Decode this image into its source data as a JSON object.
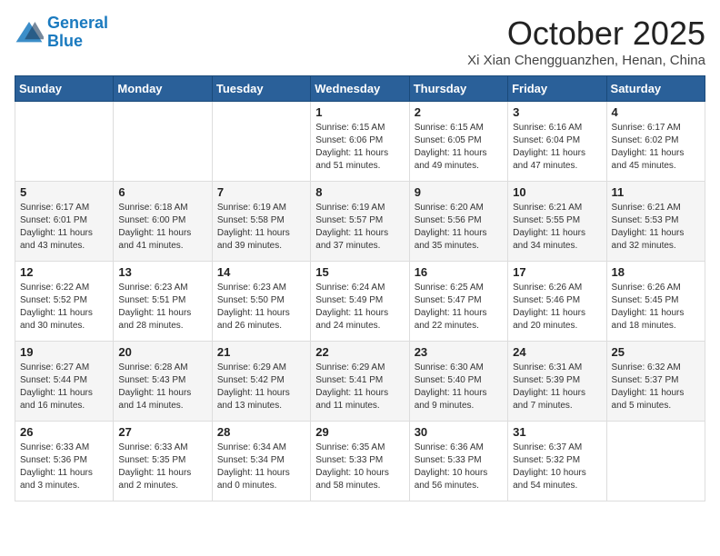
{
  "logo": {
    "line1": "General",
    "line2": "Blue"
  },
  "title": "October 2025",
  "location": "Xi Xian Chengguanzhen, Henan, China",
  "weekdays": [
    "Sunday",
    "Monday",
    "Tuesday",
    "Wednesday",
    "Thursday",
    "Friday",
    "Saturday"
  ],
  "weeks": [
    [
      {
        "day": "",
        "info": ""
      },
      {
        "day": "",
        "info": ""
      },
      {
        "day": "",
        "info": ""
      },
      {
        "day": "1",
        "info": "Sunrise: 6:15 AM\nSunset: 6:06 PM\nDaylight: 11 hours\nand 51 minutes."
      },
      {
        "day": "2",
        "info": "Sunrise: 6:15 AM\nSunset: 6:05 PM\nDaylight: 11 hours\nand 49 minutes."
      },
      {
        "day": "3",
        "info": "Sunrise: 6:16 AM\nSunset: 6:04 PM\nDaylight: 11 hours\nand 47 minutes."
      },
      {
        "day": "4",
        "info": "Sunrise: 6:17 AM\nSunset: 6:02 PM\nDaylight: 11 hours\nand 45 minutes."
      }
    ],
    [
      {
        "day": "5",
        "info": "Sunrise: 6:17 AM\nSunset: 6:01 PM\nDaylight: 11 hours\nand 43 minutes."
      },
      {
        "day": "6",
        "info": "Sunrise: 6:18 AM\nSunset: 6:00 PM\nDaylight: 11 hours\nand 41 minutes."
      },
      {
        "day": "7",
        "info": "Sunrise: 6:19 AM\nSunset: 5:58 PM\nDaylight: 11 hours\nand 39 minutes."
      },
      {
        "day": "8",
        "info": "Sunrise: 6:19 AM\nSunset: 5:57 PM\nDaylight: 11 hours\nand 37 minutes."
      },
      {
        "day": "9",
        "info": "Sunrise: 6:20 AM\nSunset: 5:56 PM\nDaylight: 11 hours\nand 35 minutes."
      },
      {
        "day": "10",
        "info": "Sunrise: 6:21 AM\nSunset: 5:55 PM\nDaylight: 11 hours\nand 34 minutes."
      },
      {
        "day": "11",
        "info": "Sunrise: 6:21 AM\nSunset: 5:53 PM\nDaylight: 11 hours\nand 32 minutes."
      }
    ],
    [
      {
        "day": "12",
        "info": "Sunrise: 6:22 AM\nSunset: 5:52 PM\nDaylight: 11 hours\nand 30 minutes."
      },
      {
        "day": "13",
        "info": "Sunrise: 6:23 AM\nSunset: 5:51 PM\nDaylight: 11 hours\nand 28 minutes."
      },
      {
        "day": "14",
        "info": "Sunrise: 6:23 AM\nSunset: 5:50 PM\nDaylight: 11 hours\nand 26 minutes."
      },
      {
        "day": "15",
        "info": "Sunrise: 6:24 AM\nSunset: 5:49 PM\nDaylight: 11 hours\nand 24 minutes."
      },
      {
        "day": "16",
        "info": "Sunrise: 6:25 AM\nSunset: 5:47 PM\nDaylight: 11 hours\nand 22 minutes."
      },
      {
        "day": "17",
        "info": "Sunrise: 6:26 AM\nSunset: 5:46 PM\nDaylight: 11 hours\nand 20 minutes."
      },
      {
        "day": "18",
        "info": "Sunrise: 6:26 AM\nSunset: 5:45 PM\nDaylight: 11 hours\nand 18 minutes."
      }
    ],
    [
      {
        "day": "19",
        "info": "Sunrise: 6:27 AM\nSunset: 5:44 PM\nDaylight: 11 hours\nand 16 minutes."
      },
      {
        "day": "20",
        "info": "Sunrise: 6:28 AM\nSunset: 5:43 PM\nDaylight: 11 hours\nand 14 minutes."
      },
      {
        "day": "21",
        "info": "Sunrise: 6:29 AM\nSunset: 5:42 PM\nDaylight: 11 hours\nand 13 minutes."
      },
      {
        "day": "22",
        "info": "Sunrise: 6:29 AM\nSunset: 5:41 PM\nDaylight: 11 hours\nand 11 minutes."
      },
      {
        "day": "23",
        "info": "Sunrise: 6:30 AM\nSunset: 5:40 PM\nDaylight: 11 hours\nand 9 minutes."
      },
      {
        "day": "24",
        "info": "Sunrise: 6:31 AM\nSunset: 5:39 PM\nDaylight: 11 hours\nand 7 minutes."
      },
      {
        "day": "25",
        "info": "Sunrise: 6:32 AM\nSunset: 5:37 PM\nDaylight: 11 hours\nand 5 minutes."
      }
    ],
    [
      {
        "day": "26",
        "info": "Sunrise: 6:33 AM\nSunset: 5:36 PM\nDaylight: 11 hours\nand 3 minutes."
      },
      {
        "day": "27",
        "info": "Sunrise: 6:33 AM\nSunset: 5:35 PM\nDaylight: 11 hours\nand 2 minutes."
      },
      {
        "day": "28",
        "info": "Sunrise: 6:34 AM\nSunset: 5:34 PM\nDaylight: 11 hours\nand 0 minutes."
      },
      {
        "day": "29",
        "info": "Sunrise: 6:35 AM\nSunset: 5:33 PM\nDaylight: 10 hours\nand 58 minutes."
      },
      {
        "day": "30",
        "info": "Sunrise: 6:36 AM\nSunset: 5:33 PM\nDaylight: 10 hours\nand 56 minutes."
      },
      {
        "day": "31",
        "info": "Sunrise: 6:37 AM\nSunset: 5:32 PM\nDaylight: 10 hours\nand 54 minutes."
      },
      {
        "day": "",
        "info": ""
      }
    ]
  ]
}
